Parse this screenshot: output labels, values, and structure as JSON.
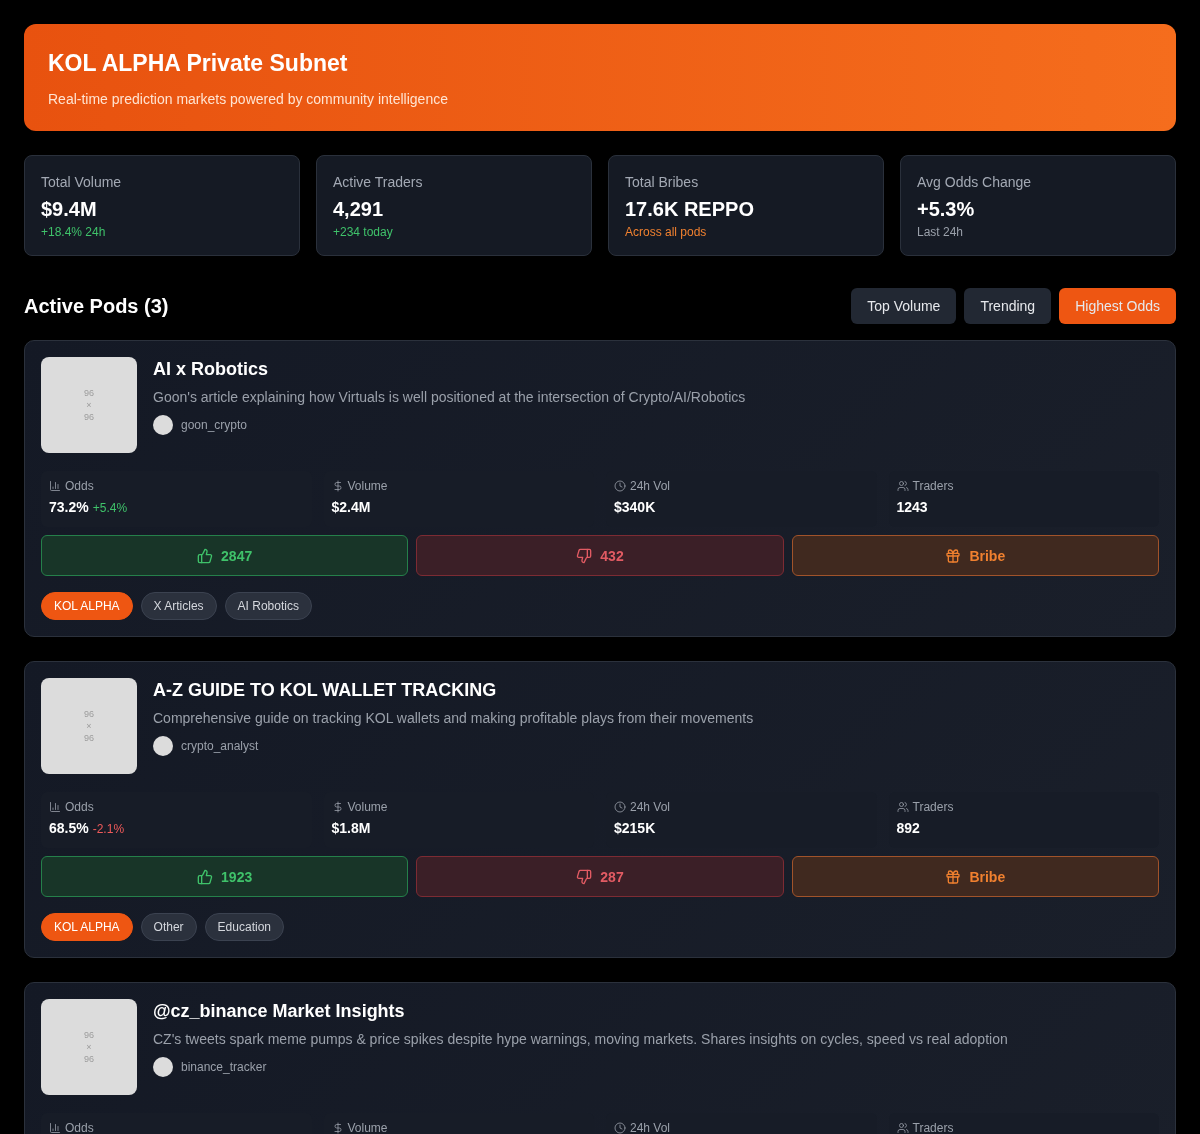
{
  "header": {
    "title": "KOL ALPHA Private Subnet",
    "subtitle": "Real-time prediction markets powered by community intelligence"
  },
  "stats": [
    {
      "label": "Total Volume",
      "value": "$9.4M",
      "note": "+18.4% 24h",
      "color": "#3fc26a"
    },
    {
      "label": "Active Traders",
      "value": "4,291",
      "note": "+234 today",
      "color": "#3fc26a"
    },
    {
      "label": "Total Bribes",
      "value": "17.6K REPPO",
      "note": "Across all pods",
      "color": "#f0802f"
    },
    {
      "label": "Avg Odds Change",
      "value": "+5.3%",
      "note": "Last 24h",
      "color": "#9aa0aa"
    }
  ],
  "section": {
    "title": "Active Pods (3)"
  },
  "sort_buttons": [
    {
      "label": "Top Volume",
      "selected": false
    },
    {
      "label": "Trending",
      "selected": false
    },
    {
      "label": "Highest Odds",
      "selected": true
    }
  ],
  "pods": [
    {
      "thumbnail_text": [
        "96",
        "×",
        "96"
      ],
      "title": "AI x Robotics",
      "description": "Goon's article explaining how Virtuals is well positioned at the intersection of Crypto/AI/Robotics",
      "author": "goon_crypto",
      "metrics": [
        {
          "kind": "odds",
          "label": "Odds",
          "value": "73.2%",
          "change": "+5.4%",
          "color": "#3fc26a"
        },
        {
          "kind": "volume",
          "label": "Volume",
          "value": "$2.4M"
        },
        {
          "kind": "vol24",
          "label": "24h Vol",
          "value": "$340K"
        },
        {
          "kind": "traders",
          "label": "Traders",
          "value": "1243"
        }
      ],
      "actions": [
        {
          "kind": "up",
          "label": "2847"
        },
        {
          "kind": "down",
          "label": "432"
        },
        {
          "kind": "bribe",
          "label": "Bribe"
        }
      ],
      "tags": [
        {
          "label": "KOL ALPHA",
          "kind": "primary"
        },
        {
          "label": "X Articles",
          "kind": "plain"
        },
        {
          "label": "AI Robotics",
          "kind": "plain"
        }
      ]
    },
    {
      "thumbnail_text": [
        "96",
        "×",
        "96"
      ],
      "title": "A-Z GUIDE TO KOL WALLET TRACKING",
      "description": "Comprehensive guide on tracking KOL wallets and making profitable plays from their movements",
      "author": "crypto_analyst",
      "metrics": [
        {
          "kind": "odds",
          "label": "Odds",
          "value": "68.5%",
          "change": "-2.1%",
          "color": "#ef5a5a"
        },
        {
          "kind": "volume",
          "label": "Volume",
          "value": "$1.8M"
        },
        {
          "kind": "vol24",
          "label": "24h Vol",
          "value": "$215K"
        },
        {
          "kind": "traders",
          "label": "Traders",
          "value": "892"
        }
      ],
      "actions": [
        {
          "kind": "up",
          "label": "1923"
        },
        {
          "kind": "down",
          "label": "287"
        },
        {
          "kind": "bribe",
          "label": "Bribe"
        }
      ],
      "tags": [
        {
          "label": "KOL ALPHA",
          "kind": "primary"
        },
        {
          "label": "Other",
          "kind": "plain"
        },
        {
          "label": "Education",
          "kind": "plain"
        }
      ]
    },
    {
      "thumbnail_text": [
        "96",
        "×",
        "96"
      ],
      "title": "@cz_binance Market Insights",
      "description": "CZ's tweets spark meme pumps & price spikes despite hype warnings, moving markets. Shares insights on cycles, speed vs real adoption",
      "author": "binance_tracker",
      "metrics": [
        {
          "kind": "odds",
          "label": "Odds"
        },
        {
          "kind": "volume",
          "label": "Volume"
        },
        {
          "kind": "vol24",
          "label": "24h Vol"
        },
        {
          "kind": "traders",
          "label": "Traders"
        }
      ]
    }
  ]
}
